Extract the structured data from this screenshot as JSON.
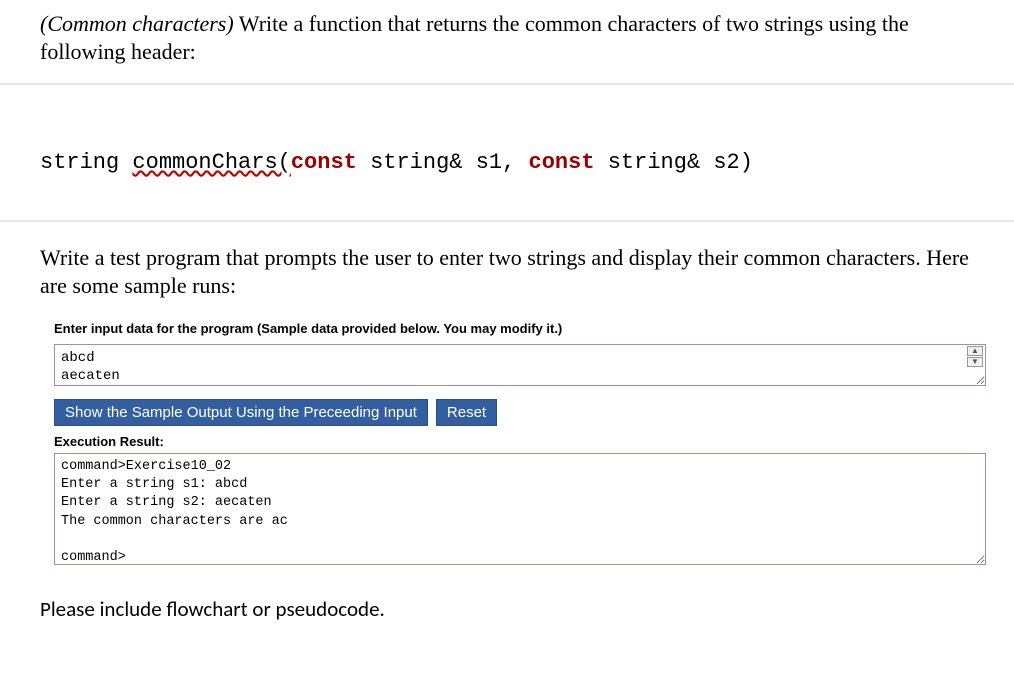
{
  "intro": {
    "emph": "(Common characters)",
    "rest": " Write a function that returns the common characters of two strings using the following header:"
  },
  "signature": {
    "t1": "string ",
    "fn": "commonChars(",
    "kw1": "const",
    "t2": " string& s1, ",
    "kw2": "const",
    "t3": " string& s2)"
  },
  "mid": "Write a test program that prompts the user to enter two strings and display their common characters. Here are some sample runs:",
  "prompt": "Enter input data for the program (Sample data provided below. You may modify it.)",
  "input_data": "abcd\naecaten",
  "buttons": {
    "show": "Show the Sample Output Using the Preceeding Input",
    "reset": "Reset"
  },
  "exec_label": "Execution Result:",
  "output": "command>Exercise10_02\nEnter a string s1: abcd\nEnter a string s2: aecaten\nThe common characters are ac\n\ncommand>",
  "footer": "Please include flowchart or pseudocode."
}
